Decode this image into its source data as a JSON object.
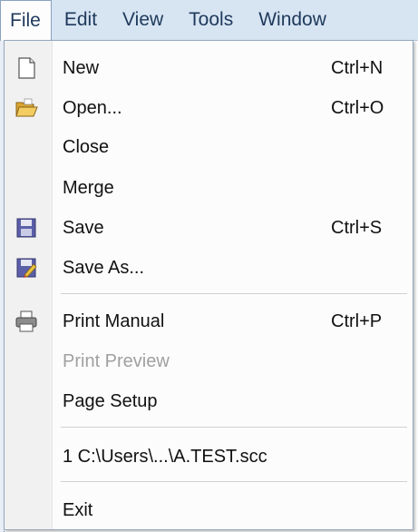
{
  "menubar": {
    "items": [
      {
        "label": "File",
        "active": true
      },
      {
        "label": "Edit"
      },
      {
        "label": "View"
      },
      {
        "label": "Tools"
      },
      {
        "label": "Window"
      }
    ]
  },
  "file_menu": {
    "items": [
      {
        "label": "New",
        "shortcut": "Ctrl+N",
        "icon": "new-document-icon"
      },
      {
        "label": "Open...",
        "shortcut": "Ctrl+O",
        "icon": "open-folder-icon"
      },
      {
        "label": "Close",
        "shortcut": ""
      },
      {
        "label": "Merge",
        "shortcut": ""
      },
      {
        "label": "Save",
        "shortcut": "Ctrl+S",
        "icon": "save-disk-icon"
      },
      {
        "label": "Save As...",
        "shortcut": "",
        "icon": "save-as-icon"
      },
      {
        "label": "Print Manual",
        "shortcut": "Ctrl+P",
        "icon": "printer-icon"
      },
      {
        "label": "Print Preview",
        "shortcut": "",
        "disabled": true
      },
      {
        "label": "Page Setup",
        "shortcut": ""
      },
      {
        "label": "1 C:\\Users\\...\\A.TEST.scc",
        "shortcut": ""
      },
      {
        "label": "Exit",
        "shortcut": ""
      }
    ]
  },
  "colors": {
    "menubar_bg": "#d7e4f2",
    "menubar_text": "#1e395b",
    "disabled_text": "#a0a0a0"
  }
}
